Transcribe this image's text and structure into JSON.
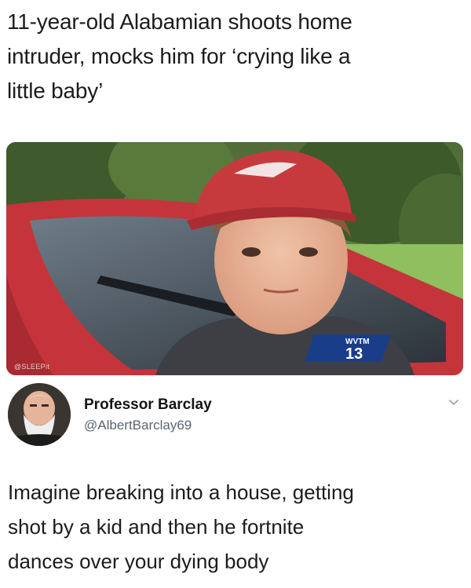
{
  "headline": {
    "line1": "11-year-old Alabamian shoots home",
    "line2": "intruder, mocks him for ‘crying like a",
    "line3": "little baby’"
  },
  "photo": {
    "watermark": "@SLEEPit",
    "station_logo": {
      "call_sign": "WVTM",
      "channel": "13"
    }
  },
  "tweet": {
    "display_name": "Professor Barclay",
    "handle": "@AlbertBarclay69",
    "text_line1": "Imagine breaking into a house, getting",
    "text_line2": "shot by a kid and then he fortnite",
    "text_line3": "dances over your dying body"
  },
  "icons": {
    "avatar": "bearded-man-avatar",
    "menu": "chevron-down-icon"
  },
  "colors": {
    "text": "#1c1c1c",
    "handle": "#5b6670",
    "cap_red": "#c63a3e",
    "car_red": "#c5343a"
  }
}
